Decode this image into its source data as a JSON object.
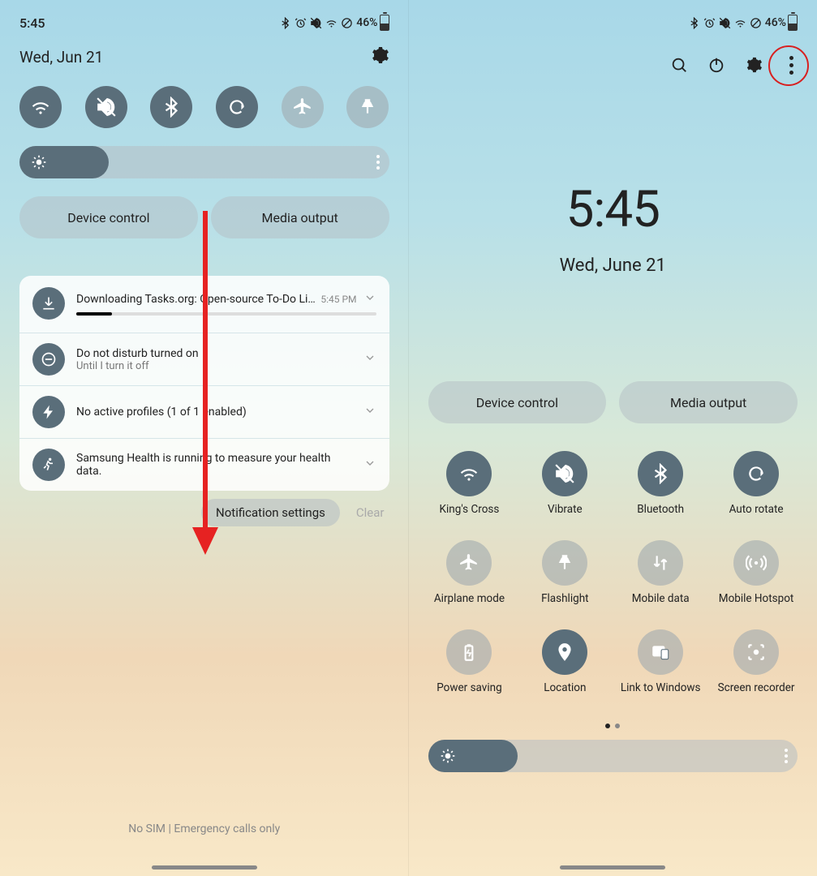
{
  "status": {
    "time": "5:45",
    "battery_pct": "46%"
  },
  "left": {
    "date": "Wed, Jun 21",
    "toggles": [
      {
        "name": "wifi",
        "on": true
      },
      {
        "name": "sound",
        "on": true
      },
      {
        "name": "bluetooth",
        "on": true
      },
      {
        "name": "rotate",
        "on": true
      },
      {
        "name": "airplane",
        "on": false
      },
      {
        "name": "flashlight",
        "on": false
      }
    ],
    "pills": {
      "device": "Device control",
      "media": "Media output"
    },
    "notifs": {
      "download": {
        "title": "Downloading Tasks.org: Open-source To-Do Lists &...",
        "time": "5:45 PM"
      },
      "dnd": {
        "title": "Do not disturb turned on",
        "sub": "Until I turn it off"
      },
      "profiles": {
        "title": "No active profiles (1 of 1 enabled)"
      },
      "health": {
        "title": "Samsung Health is running to measure your health data."
      }
    },
    "actions": {
      "settings": "Notification settings",
      "clear": "Clear"
    },
    "footer": "No SIM | Emergency calls only"
  },
  "right": {
    "clock": "5:45",
    "date": "Wed, June 21",
    "pills": {
      "device": "Device control",
      "media": "Media output"
    },
    "tiles": [
      {
        "name": "wifi",
        "label": "King's Cross",
        "on": true
      },
      {
        "name": "sound",
        "label": "Vibrate",
        "on": true
      },
      {
        "name": "bluetooth",
        "label": "Bluetooth",
        "on": true
      },
      {
        "name": "rotate",
        "label": "Auto rotate",
        "on": true
      },
      {
        "name": "airplane",
        "label": "Airplane mode",
        "on": false
      },
      {
        "name": "flashlight",
        "label": "Flashlight",
        "on": false
      },
      {
        "name": "mobiledata",
        "label": "Mobile data",
        "on": false
      },
      {
        "name": "hotspot",
        "label": "Mobile Hotspot",
        "on": false
      },
      {
        "name": "powersave",
        "label": "Power saving",
        "on": false
      },
      {
        "name": "location",
        "label": "Location",
        "on": true
      },
      {
        "name": "link",
        "label": "Link to Windows",
        "on": false
      },
      {
        "name": "screenrec",
        "label": "Screen recorder",
        "on": false
      }
    ]
  }
}
